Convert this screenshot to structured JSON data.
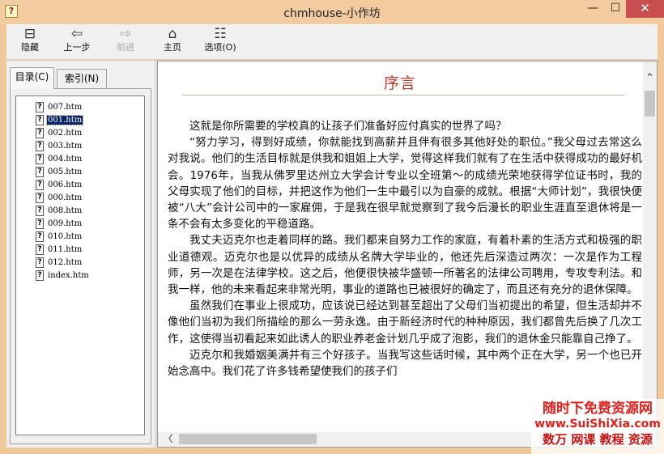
{
  "window": {
    "title": "chmhouse-小作坊",
    "minimize_glyph": "—",
    "maximize_glyph": "☐",
    "close_glyph": "✕",
    "app_icon_glyph": "?"
  },
  "toolbar": {
    "hide": {
      "label": "隐藏",
      "icon": "hide-pane-icon",
      "glyph": "⊟"
    },
    "back": {
      "label": "上一步",
      "icon": "back-arrow-icon",
      "glyph": "⇦"
    },
    "forward": {
      "label": "前进",
      "icon": "forward-arrow-icon",
      "glyph": "⇨"
    },
    "home": {
      "label": "主页",
      "icon": "home-icon",
      "glyph": "⌂"
    },
    "options": {
      "label": "选项(O)",
      "icon": "options-icon",
      "glyph": "☷"
    }
  },
  "nav": {
    "tabs": [
      {
        "label": "目录(C)"
      },
      {
        "label": "索引(N)"
      }
    ],
    "items": [
      {
        "label": "007.htm",
        "glyph": "?"
      },
      {
        "label": "001.htm",
        "glyph": "?"
      },
      {
        "label": "002.htm",
        "glyph": "?"
      },
      {
        "label": "003.htm",
        "glyph": "?"
      },
      {
        "label": "004.htm",
        "glyph": "?"
      },
      {
        "label": "005.htm",
        "glyph": "?"
      },
      {
        "label": "006.htm",
        "glyph": "?"
      },
      {
        "label": "000.htm",
        "glyph": "?"
      },
      {
        "label": "008.htm",
        "glyph": "?"
      },
      {
        "label": "009.htm",
        "glyph": "?"
      },
      {
        "label": "010.htm",
        "glyph": "?"
      },
      {
        "label": "011.htm",
        "glyph": "?"
      },
      {
        "label": "012.htm",
        "glyph": "?"
      },
      {
        "label": "index.htm",
        "glyph": "?"
      }
    ],
    "selected_item": "001.htm"
  },
  "document": {
    "title": "序言",
    "paragraphs": [
      "这就是你所需要的学校真的让孩子们准备好应付真实的世界了吗？",
      "“努力学习，得到好成绩，你就能找到高薪并且伴有很多其他好处的职位。”我父母过去常这么对我说。他们的生活目标就是供我和姐姐上大学，觉得这样我们就有了在生活中获得成功的最好机会。1976年，当我从佛罗里达州立大学会计专业以全班第～的成绩光荣地获得学位证书时，我的父母实现了他们的目标，并把这作为他们一生中最引以为自豪的成就。根据“大师计划”，我很快便被“八大”会计公司中的一家雇佣，于是我在很早就觉察到了我今后漫长的职业生涯直至退休将是一条不会有太多变化的平稳道路。",
      "我丈夫迈克尔也走着同样的路。我们都来自努力工作的家庭，有着朴素的生活方式和极强的职业道德观。迈克尔也是以优异的成绩从名牌大学毕业的，他还先后深造过两次：一次是作为工程师，另一次是在法律学校。这之后，他便很快被华盛顿一所著名的法律公司聘用，专攻专利法。和我一样，他的未来看起来非常光明，事业的道路也已被很好的确定了，而且还有充分的退休保障。",
      "虽然我们在事业上很成功，应该说已经达到甚至超出了父母们当初提出的希望，但生活却并不像他们当初为我们所描绘的那么一劳永逸。由于新经济时代的种种原因，我们都曾先后换了几次工作，这使得当初看起来如此诱人的职业养老金计划几乎成了泡影，我们的退休金只能靠自己挣了。",
      "迈克尔和我婚姻美满并有三个好孩子。当我写这些话时候，其中两个正在大学，另一个也已开始念高中。我们花了许多钱希望使我们的孩子们"
    ]
  },
  "scrollbars": {
    "up_glyph": "⌃",
    "left_glyph": "〈"
  },
  "watermark": {
    "line1": "随时下免费资源网",
    "line2": "www.SuiShiXia.com",
    "line3": "数万 网课 教程 资源"
  }
}
